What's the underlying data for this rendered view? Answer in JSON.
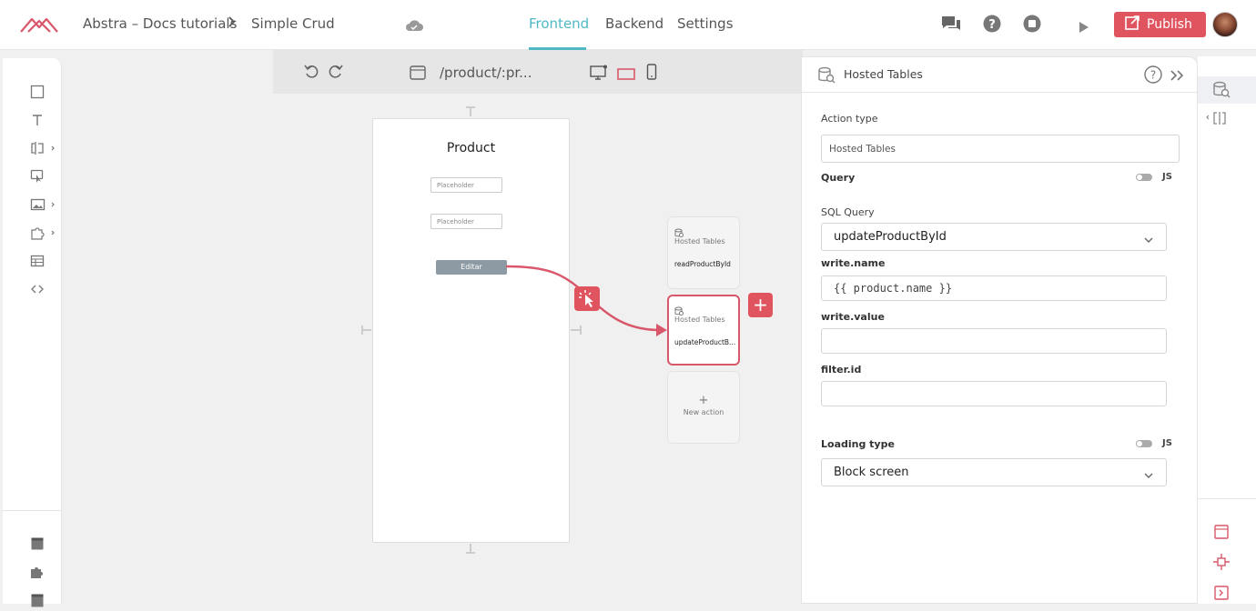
{
  "header": {
    "breadcrumb_project": "Abstra – Docs tutorials",
    "breadcrumb_page": "Simple Crud",
    "tabs": [
      "Frontend",
      "Backend",
      "Settings"
    ],
    "active_tab": "Frontend",
    "publish_label": "Publish",
    "accent_color": "#4fb8c6",
    "brand_color": "#e0545f"
  },
  "canvas_toolbar": {
    "route": "/product/:pr..."
  },
  "page_preview": {
    "title": "Product",
    "inputs": [
      "Placeholder",
      "Placeholder"
    ],
    "button_label": "Editar"
  },
  "actions": [
    {
      "type": "Hosted Tables",
      "name": "readProductById",
      "selected": false
    },
    {
      "type": "Hosted Tables",
      "name": "updateProductB...",
      "selected": true
    }
  ],
  "new_action_label": "New action",
  "panel": {
    "title": "Hosted Tables",
    "action_type_label": "Action type",
    "action_type_value": "Hosted Tables",
    "query_label": "Query",
    "js_label": "JS",
    "sql_query_label": "SQL Query",
    "sql_query_value": "updateProductById",
    "write_name_label": "write.name",
    "write_name_value": "{{ product.name }}",
    "write_value_label": "write.value",
    "write_value_value": "",
    "filter_id_label": "filter.id",
    "filter_id_value": "",
    "loading_type_label": "Loading type",
    "loading_type_value": "Block screen"
  }
}
